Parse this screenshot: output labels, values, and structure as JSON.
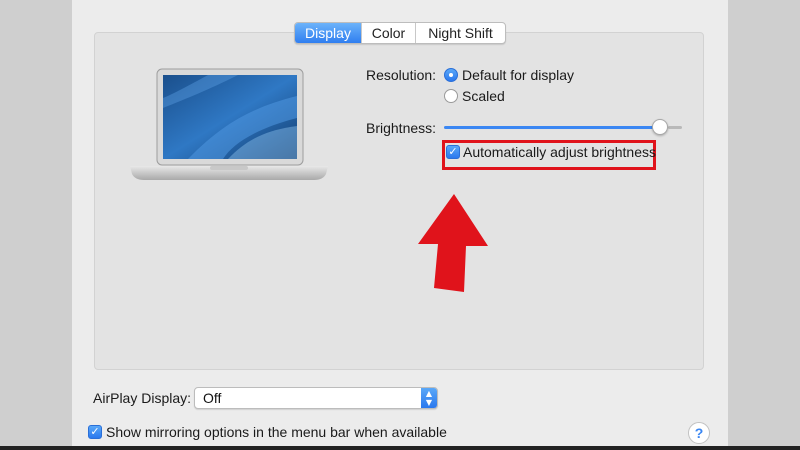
{
  "tabs": [
    {
      "label": "Display",
      "active": true
    },
    {
      "label": "Color",
      "active": false
    },
    {
      "label": "Night Shift",
      "active": false
    }
  ],
  "resolution": {
    "label": "Resolution:",
    "options": [
      {
        "label": "Default for display",
        "selected": true
      },
      {
        "label": "Scaled",
        "selected": false
      }
    ]
  },
  "brightness": {
    "label": "Brightness:",
    "level": 0.92,
    "auto_adjust_label": "Automatically adjust brightness",
    "auto_adjust_checked": true
  },
  "airplay": {
    "label": "AirPlay Display:",
    "value": "Off"
  },
  "mirroring": {
    "label": "Show mirroring options in the menu bar when available",
    "checked": true
  },
  "help": {
    "label": "?"
  },
  "icons": {
    "laptop": "macbook-air-icon",
    "arrow": "red-up-arrow-annotation",
    "help": "help-icon"
  },
  "colors": {
    "accent": "#3b87f3",
    "annotation": "#e0131b"
  }
}
